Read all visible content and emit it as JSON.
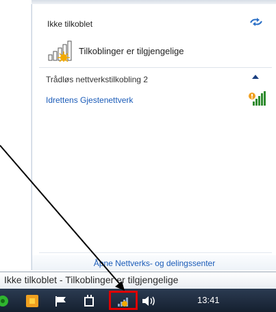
{
  "panel": {
    "status_title": "Ikke tilkoblet",
    "refresh_icon": "refresh-arrows-icon",
    "connections_label": "Tilkoblinger er tilgjengelige",
    "section_title": "Trådløs nettverkstilkobling 2",
    "networks": [
      {
        "name": "Idrettens Gjestenettverk",
        "signal_icon": "wifi-signal-warning-icon"
      }
    ],
    "footer_link": "Åpne Nettverks- og delingssenter"
  },
  "tooltip": {
    "text": "Ikke tilkoblet - Tilkoblinger er tilgjengelige"
  },
  "taskbar": {
    "clock": "13:41",
    "tray_icons": [
      "green-app-icon",
      "orange-app-icon",
      "action-center-flag-icon",
      "power-icon",
      "network-status-icon",
      "volume-icon"
    ]
  },
  "colors": {
    "link_blue": "#1a5bb8",
    "highlight_red": "#e00000",
    "taskbar_dark": "#1c2a3c"
  }
}
